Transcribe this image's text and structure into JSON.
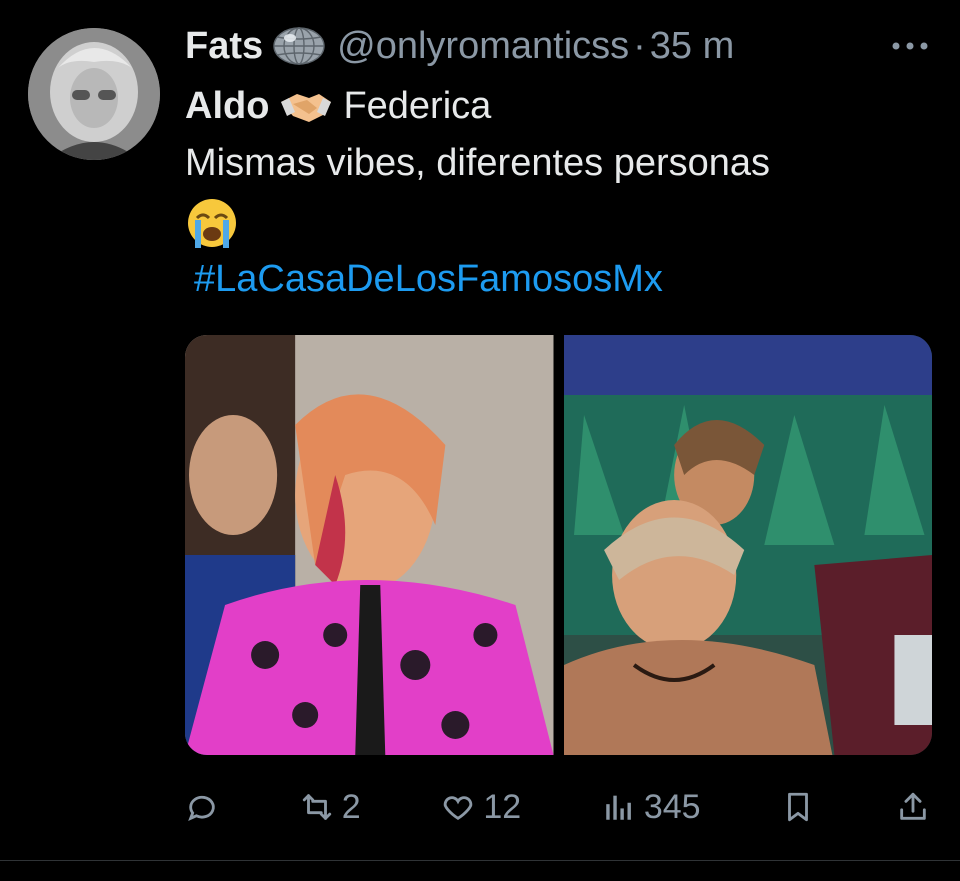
{
  "tweet": {
    "author_name": "Fats",
    "author_handle": "@onlyromanticss",
    "separator": "·",
    "time": "35 m",
    "line1_left": "Aldo",
    "line1_right": "Federica",
    "line2": "Mismas vibes, diferentes personas",
    "hashtag": "#LaCasaDeLosFamososMx"
  },
  "actions": {
    "retweets": "2",
    "likes": "12",
    "views": "345"
  },
  "icons": {
    "name_badge": "disco-ball-icon",
    "line1_emoji": "handshake-icon",
    "line3_emoji": "crying-face-icon",
    "more": "more-icon",
    "reply": "reply-icon",
    "retweet": "retweet-icon",
    "like": "heart-icon",
    "views": "views-icon",
    "bookmark": "bookmark-icon",
    "share": "share-icon"
  },
  "colors": {
    "background": "#000000",
    "text": "#e7e9ea",
    "muted": "#8b98a5",
    "link": "#1d9bf0"
  }
}
